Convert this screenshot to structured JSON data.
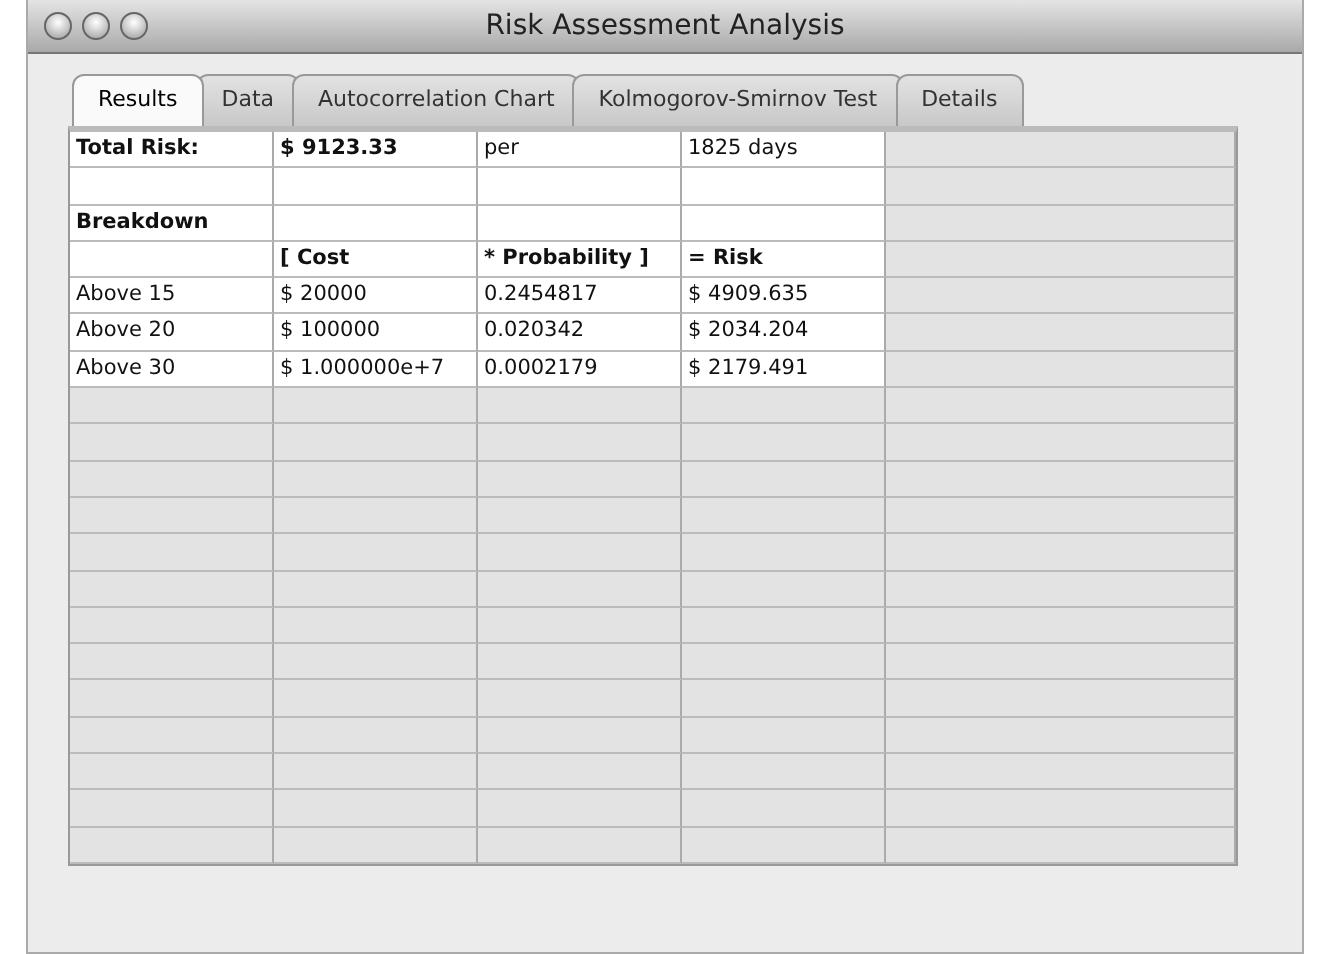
{
  "window": {
    "title": "Risk Assessment Analysis"
  },
  "tabs": [
    {
      "label": "Results",
      "selected": true
    },
    {
      "label": "Data",
      "selected": false
    },
    {
      "label": "Autocorrelation Chart",
      "selected": false
    },
    {
      "label": "Kolmogorov-Smirnov Test",
      "selected": false
    },
    {
      "label": "Details",
      "selected": false
    }
  ],
  "table": {
    "rows": [
      [
        {
          "text": "Total Risk:",
          "bold": true
        },
        {
          "text": "$ 9123.33",
          "bold": true
        },
        {
          "text": "per",
          "bold": false
        },
        {
          "text": "1825 days",
          "bold": false
        }
      ],
      [
        null,
        null,
        null,
        null
      ],
      [
        {
          "text": "Breakdown",
          "bold": true
        },
        null,
        null,
        null
      ],
      [
        null,
        {
          "text": "[ Cost",
          "bold": true
        },
        {
          "text": "* Probability ]",
          "bold": true
        },
        {
          "text": "= Risk",
          "bold": true
        }
      ],
      [
        {
          "text": "Above 15",
          "bold": false
        },
        {
          "text": "$ 20000",
          "bold": false
        },
        {
          "text": "0.2454817",
          "bold": false
        },
        {
          "text": "$ 4909.635",
          "bold": false
        }
      ],
      [
        {
          "text": "Above 20",
          "bold": false
        },
        {
          "text": "$ 100000",
          "bold": false
        },
        {
          "text": "0.020342",
          "bold": false
        },
        {
          "text": "$ 2034.204",
          "bold": false
        }
      ],
      [
        {
          "text": "Above 30",
          "bold": false
        },
        {
          "text": "$ 1.000000e+7",
          "bold": false
        },
        {
          "text": "0.0002179",
          "bold": false
        },
        {
          "text": "$ 2179.491",
          "bold": false
        }
      ]
    ]
  }
}
